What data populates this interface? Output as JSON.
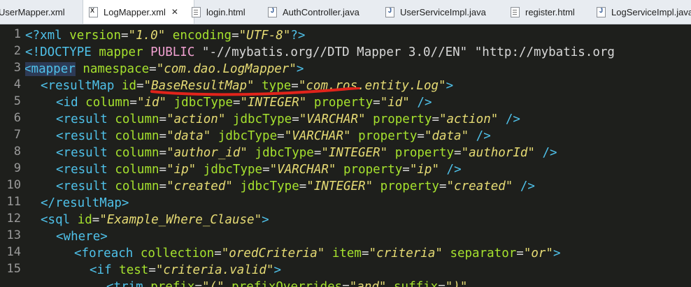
{
  "tabs": [
    {
      "label": "UserMapper.xml",
      "icon": "xml-file-icon",
      "active": false
    },
    {
      "label": "LogMapper.xml",
      "icon": "xml-file-icon",
      "active": true
    },
    {
      "label": "login.html",
      "icon": "html-file-icon",
      "active": false
    },
    {
      "label": "AuthController.java",
      "icon": "java-file-icon",
      "active": false
    },
    {
      "label": "UserServiceImpl.java",
      "icon": "java-file-icon",
      "active": false
    },
    {
      "label": "register.html",
      "icon": "html-file-icon",
      "active": false
    },
    {
      "label": "LogServiceImpl.java",
      "icon": "java-file-icon",
      "active": false
    }
  ],
  "close_glyph": "✕",
  "line_numbers": [
    "1",
    "2",
    "3",
    "4",
    "5",
    "6",
    "7",
    "8",
    "9",
    "10",
    "11",
    "12",
    "13",
    "14",
    "15"
  ],
  "code": {
    "l1": {
      "open": "<?",
      "name": "xml",
      "a1": "version",
      "v1": "\"1.0\"",
      "a2": "encoding",
      "v2": "\"UTF-8\"",
      "close": "?>"
    },
    "l2": {
      "open": "<!",
      "name": "DOCTYPE",
      "t1": "mapper",
      "t2": "PUBLIC",
      "v1": "\"-//mybatis.org//DTD Mapper 3.0//EN\"",
      "v2": "\"http://mybatis.org"
    },
    "l3": {
      "open": "<",
      "name": "mapper",
      "a1": "namespace",
      "v1a": "\"com.dao.",
      "v1b": "LogMapper\"",
      "close": ">"
    },
    "l4": {
      "open": "<",
      "name": "resultMap",
      "a1": "id",
      "v1": "\"BaseResultMap\"",
      "a2": "type",
      "v2": "\"com.ros.entity.Log\"",
      "close": ">"
    },
    "l5": {
      "open": "<",
      "name": "id",
      "a1": "column",
      "v1": "\"id\"",
      "a2": "jdbcType",
      "v2": "\"INTEGER\"",
      "a3": "property",
      "v3": "\"id\"",
      "close": "/>"
    },
    "l6": {
      "open": "<",
      "name": "result",
      "a1": "column",
      "v1": "\"action\"",
      "a2": "jdbcType",
      "v2": "\"VARCHAR\"",
      "a3": "property",
      "v3": "\"action\"",
      "close": "/>"
    },
    "l7": {
      "open": "<",
      "name": "result",
      "a1": "column",
      "v1": "\"data\"",
      "a2": "jdbcType",
      "v2": "\"VARCHAR\"",
      "a3": "property",
      "v3": "\"data\"",
      "close": "/>"
    },
    "l8": {
      "open": "<",
      "name": "result",
      "a1": "column",
      "v1": "\"author_id\"",
      "a2": "jdbcType",
      "v2": "\"INTEGER\"",
      "a3": "property",
      "v3": "\"authorId\"",
      "close": "/>"
    },
    "l9": {
      "open": "<",
      "name": "result",
      "a1": "column",
      "v1": "\"ip\"",
      "a2": "jdbcType",
      "v2": "\"VARCHAR\"",
      "a3": "property",
      "v3": "\"ip\"",
      "close": "/>"
    },
    "l10": {
      "open": "<",
      "name": "result",
      "a1": "column",
      "v1": "\"created\"",
      "a2": "jdbcType",
      "v2": "\"INTEGER\"",
      "a3": "property",
      "v3": "\"created\"",
      "close": "/>"
    },
    "l11": {
      "open": "</",
      "name": "resultMap",
      "close": ">"
    },
    "l12": {
      "open": "<",
      "name": "sql",
      "a1": "id",
      "v1": "\"Example_Where_Clause\"",
      "close": ">"
    },
    "l13": {
      "open": "<",
      "name": "where",
      "close": ">"
    },
    "l14": {
      "open": "<",
      "name": "foreach",
      "a1": "collection",
      "v1": "\"oredCriteria\"",
      "a2": "item",
      "v2": "\"criteria\"",
      "a3": "separator",
      "v3": "\"or\"",
      "close": ">"
    },
    "l15": {
      "open": "<",
      "name": "if",
      "a1": "test",
      "v1": "\"criteria.valid\"",
      "close": ">"
    },
    "l16": {
      "open": "<",
      "name": "trim",
      "a1": "prefix",
      "v1": "\"(\"",
      "a2": "prefixOverrides",
      "v2": "\"and\"",
      "a3": "suffix",
      "v3": "\")\""
    }
  },
  "colors": {
    "background": "#1e1f1c",
    "tag": "#4fc1e9",
    "attribute": "#a6e22e",
    "string": "#e6db74",
    "annotation": "#e0241b"
  }
}
